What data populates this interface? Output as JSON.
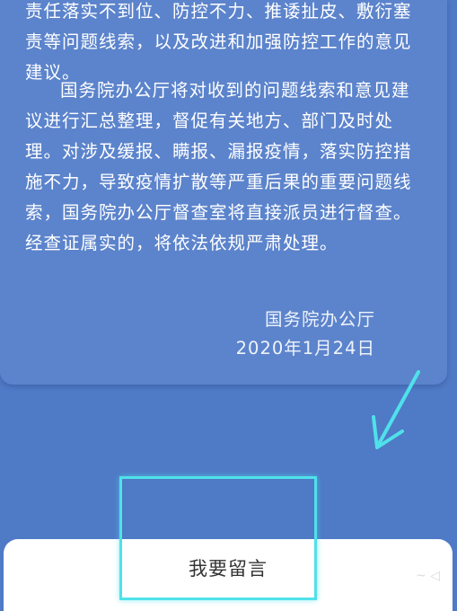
{
  "notice": {
    "paragraph1": "责任落实不到位、防控不力、推诿扯皮、敷衍塞责等问题线索，以及改进和加强防控工作的意见建议。",
    "paragraph2": "国务院办公厅将对收到的问题线索和意见建议进行汇总整理，督促有关地方、部门及时处理。对涉及缓报、瞒报、漏报疫情，落实防控措施不力，导致疫情扩散等严重后果的重要问题线索，国务院办公厅督查室将直接派员进行督查。经查证属实的，将依法依规严肃处理。",
    "signature_org": "国务院办公厅",
    "signature_date": "2020年1月24日"
  },
  "bottom_sheet": {
    "leave_message_label": "我要留言"
  },
  "annotation": {
    "arrow_color": "#4fe1ea",
    "highlight_color": "#4fe1ea"
  },
  "colors": {
    "background": "#4f7ac6",
    "card": "#5c84cc",
    "text": "#ffffff"
  }
}
